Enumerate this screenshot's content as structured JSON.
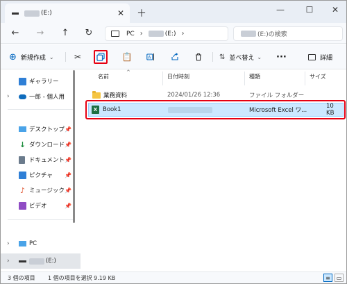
{
  "tab": {
    "label": "(E:)"
  },
  "address": {
    "pc": "PC",
    "drive": "(E:)"
  },
  "search": {
    "placeholder": "(E:)の検索"
  },
  "toolbar": {
    "new_label": "新規作成",
    "sort_label": "並べ替え",
    "details_label": "詳細"
  },
  "sidebar": {
    "gallery": "ギャラリー",
    "onedrive": "一郎 - 個人用",
    "desktop": "デスクトップ",
    "downloads": "ダウンロード",
    "documents": "ドキュメント",
    "pictures": "ピクチャ",
    "music": "ミュージック",
    "videos": "ビデオ",
    "pc": "PC",
    "drive": "(E:)"
  },
  "columns": {
    "name": "名前",
    "date": "日付時刻",
    "type": "種類",
    "size": "サイズ"
  },
  "rows": [
    {
      "name": "業務資料",
      "date": "2024/01/26 12:36",
      "type": "ファイル フォルダー",
      "size": ""
    },
    {
      "name": "Book1",
      "date": "",
      "type": "Microsoft Excel ワ...",
      "size": "10 KB"
    }
  ],
  "status": {
    "count": "3 個の項目",
    "selected": "1 個の項目を選択  9.19 KB"
  },
  "colors": {
    "accent": "#0067c0",
    "highlight": "#e60012",
    "selection": "#cce8ff"
  }
}
